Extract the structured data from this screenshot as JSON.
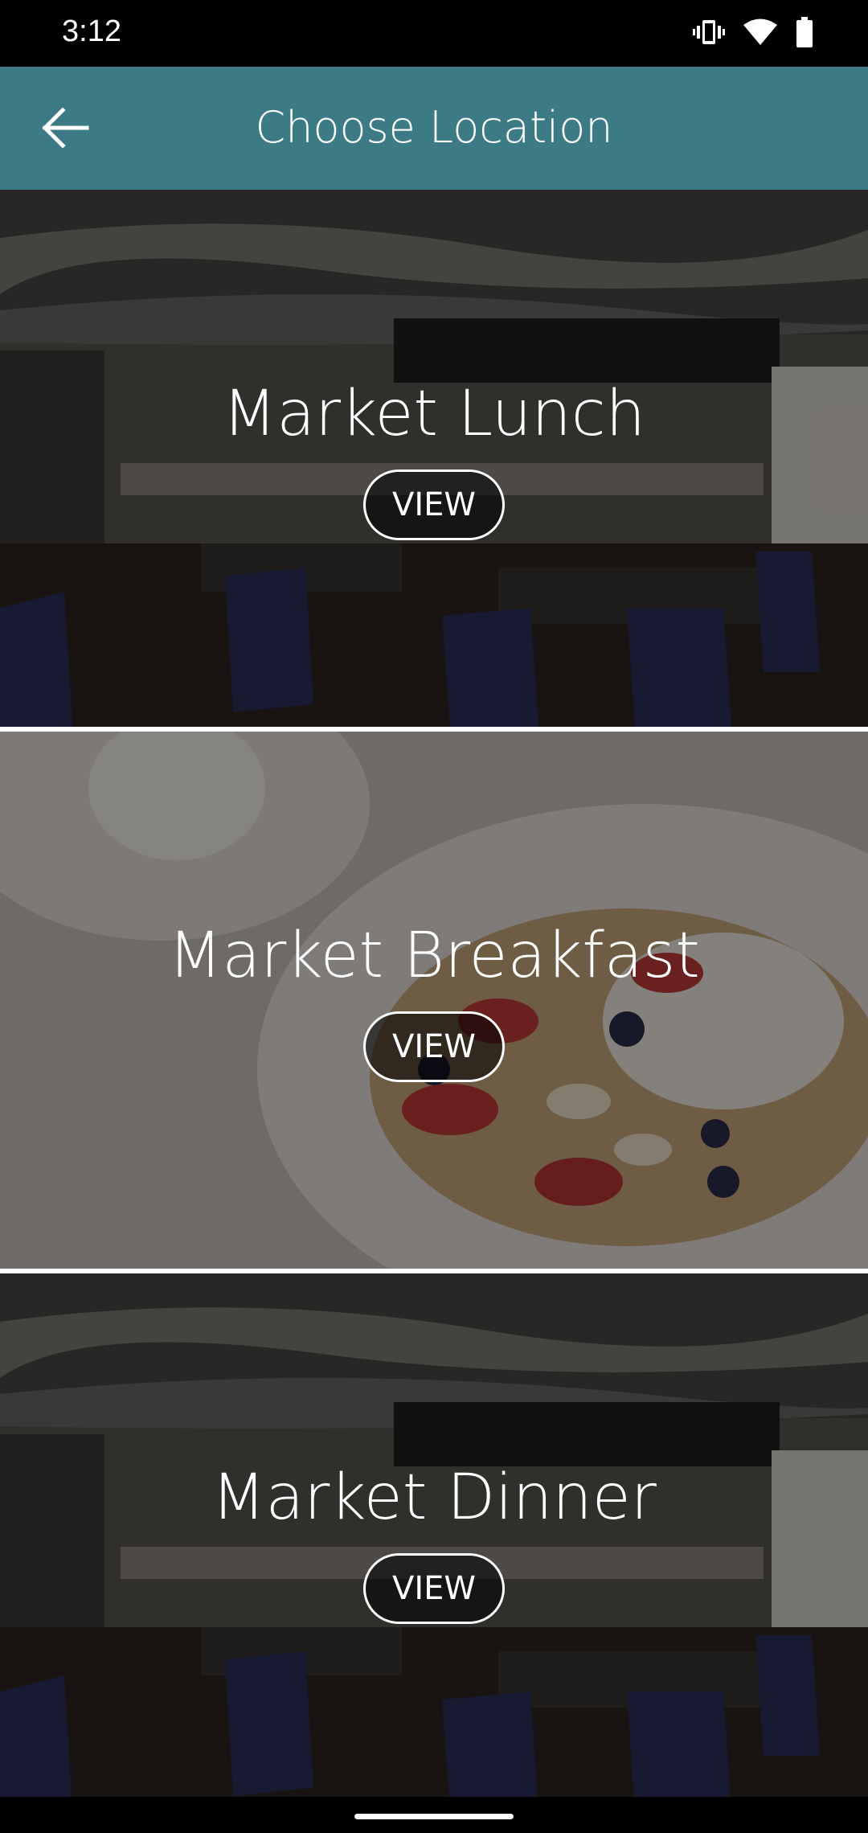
{
  "status_bar": {
    "time": "3:12",
    "icons": [
      "vibrate-icon",
      "wifi-icon",
      "battery-icon"
    ]
  },
  "app_bar": {
    "title": "Choose Location",
    "back_icon": "arrow-left-icon",
    "color": "#3c7b85"
  },
  "locations": [
    {
      "name": "Market Lunch",
      "button_label": "VIEW",
      "image": "restaurant-interior"
    },
    {
      "name": "Market Breakfast",
      "button_label": "VIEW",
      "image": "yogurt-granola-berries"
    },
    {
      "name": "Market Dinner",
      "button_label": "VIEW",
      "image": "restaurant-interior"
    }
  ]
}
